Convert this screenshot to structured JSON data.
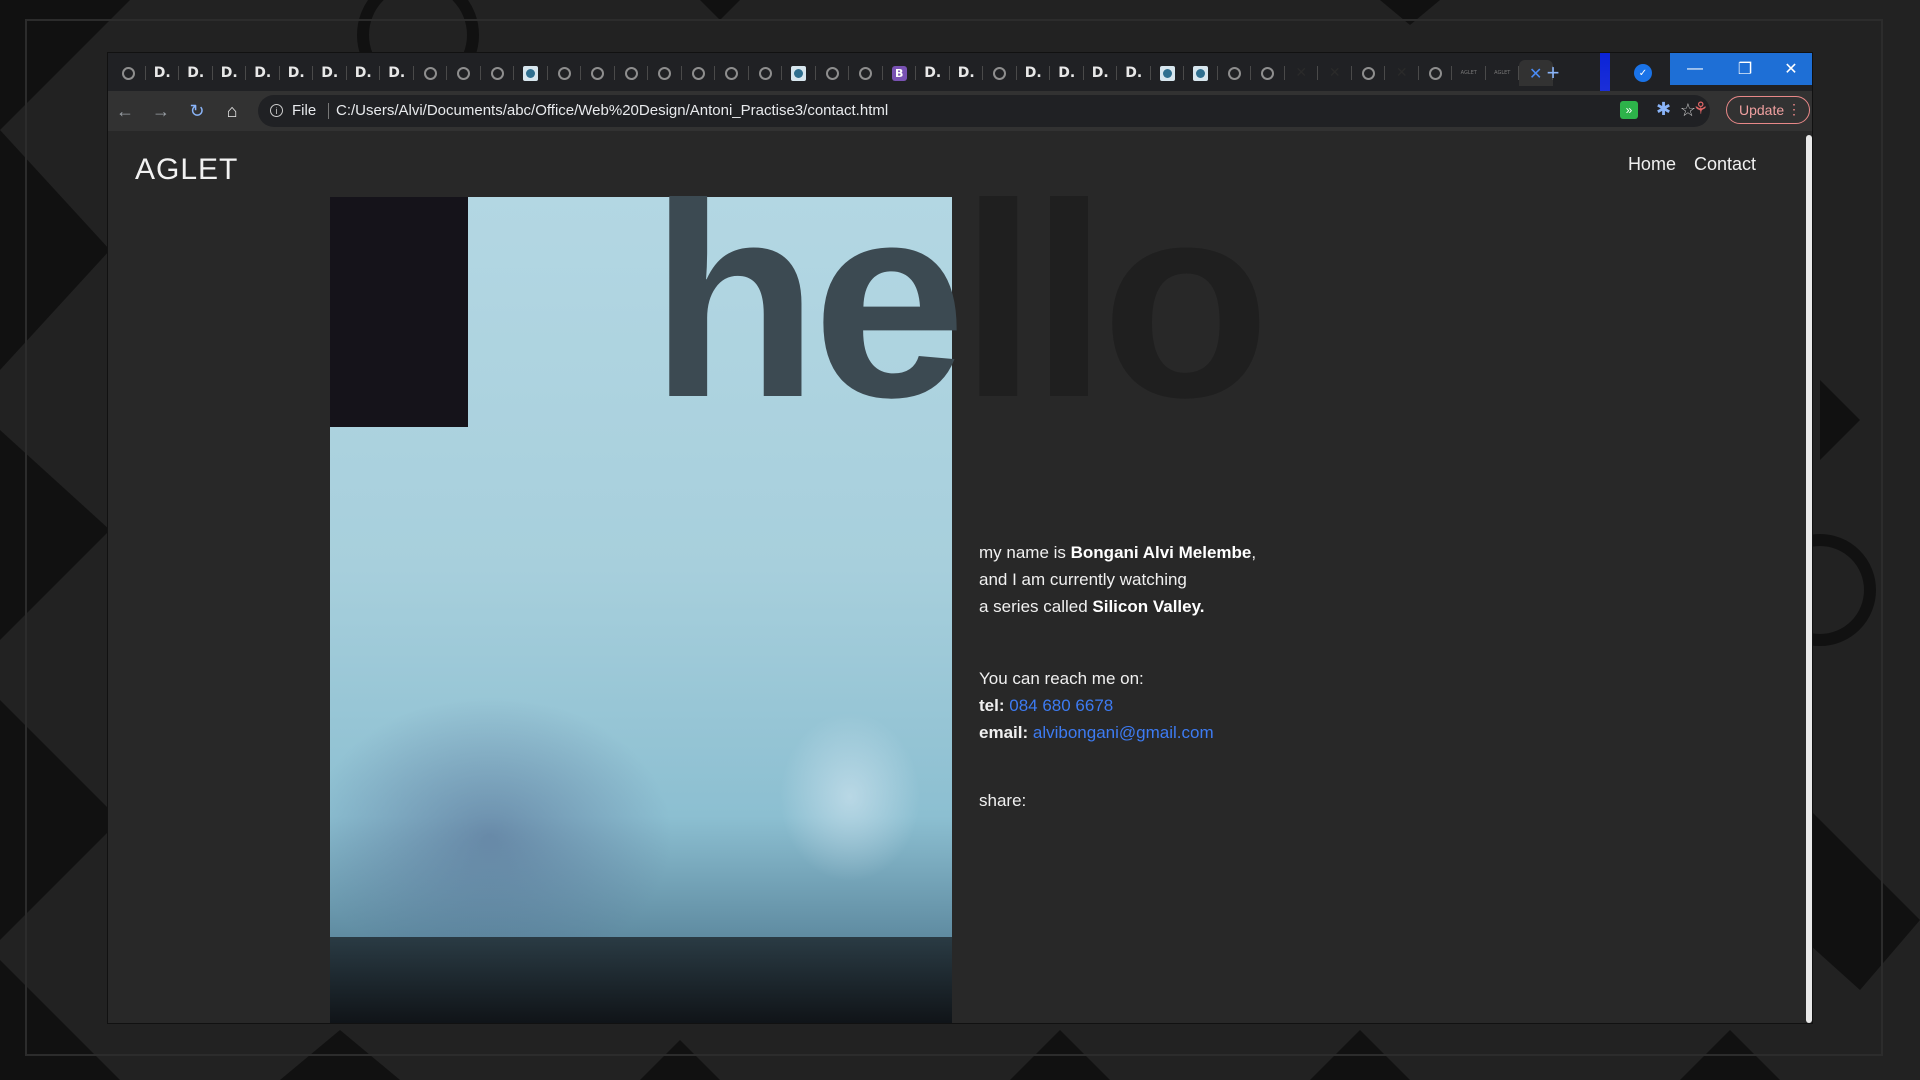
{
  "browser": {
    "tabs": [
      {
        "icon": "globe"
      },
      {
        "label": "D."
      },
      {
        "label": "D."
      },
      {
        "label": "D."
      },
      {
        "label": "D."
      },
      {
        "label": "D."
      },
      {
        "label": "D."
      },
      {
        "label": "D."
      },
      {
        "label": "D."
      },
      {
        "icon": "globe"
      },
      {
        "icon": "globe"
      },
      {
        "icon": "globe"
      },
      {
        "icon": "image"
      },
      {
        "icon": "globe"
      },
      {
        "icon": "globe"
      },
      {
        "icon": "globe"
      },
      {
        "icon": "globe"
      },
      {
        "icon": "globe"
      },
      {
        "icon": "globe"
      },
      {
        "icon": "globe"
      },
      {
        "icon": "image"
      },
      {
        "icon": "globe"
      },
      {
        "icon": "globe"
      },
      {
        "label": "B",
        "icon": "bootstrap"
      },
      {
        "label": "D."
      },
      {
        "label": "D."
      },
      {
        "icon": "globe"
      },
      {
        "label": "D."
      },
      {
        "label": "D."
      },
      {
        "label": "D."
      },
      {
        "label": "D."
      },
      {
        "icon": "image"
      },
      {
        "icon": "image"
      },
      {
        "icon": "globe"
      },
      {
        "icon": "globe"
      },
      {
        "icon": "x-mark"
      },
      {
        "icon": "x-mark"
      },
      {
        "icon": "globe"
      },
      {
        "icon": "x-mark"
      },
      {
        "icon": "globe"
      },
      {
        "label": "AGLET",
        "icon": "tiny"
      },
      {
        "label": "AGLET",
        "icon": "tiny"
      },
      {
        "label": "✕",
        "icon": "close",
        "active": true
      }
    ],
    "new_tab": "+",
    "window_controls": {
      "minimize": "—",
      "restore": "❐",
      "close": "✕"
    },
    "toolbar": {
      "back": "←",
      "forward": "→",
      "reload": "↻",
      "home": "⌂",
      "scheme": "File",
      "url": "C:/Users/Alvi/Documents/abc/Office/Web%20Design/Antoni_Practise3/contact.html",
      "bookmark": "☆",
      "update_label": "Update",
      "menu": "⋮"
    }
  },
  "site": {
    "logo": "AGLET",
    "nav": [
      "Home",
      "Contact"
    ],
    "hello_part1": "he",
    "hello_part2": "llo",
    "bio": {
      "line1_prefix": "my name is ",
      "name": "Bongani Alvi Melembe",
      "line1_suffix": ",",
      "line2": "and I am currently watching",
      "line3_prefix": "a series called ",
      "series": "Silicon Valley."
    },
    "contact": {
      "intro": "You can reach me on:",
      "tel_label": "tel:",
      "tel": "084 680 6678",
      "email_label": "email:",
      "email": "alvibongani@gmail.com"
    },
    "share_label": "share:"
  },
  "colors": {
    "page_bg": "#282828",
    "link": "#3d7bf2",
    "accent_blue": "#1e6fd6"
  }
}
